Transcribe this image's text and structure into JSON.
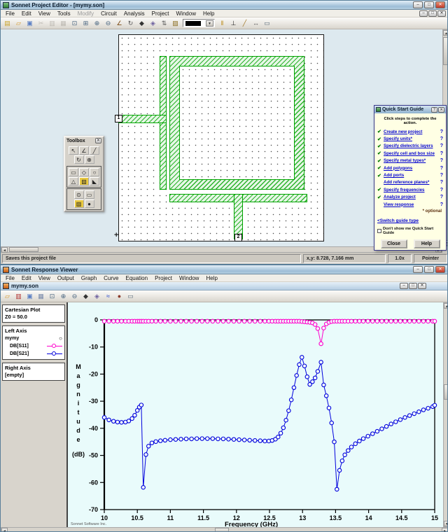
{
  "ui": {
    "scroll_up": "▲",
    "scroll_down": "▼",
    "scroll_left": "◄",
    "scroll_right": "►",
    "dropdown_arrow": "▼",
    "origin_glyph": "+",
    "marker_circle": "○",
    "help_mark": "?"
  },
  "editor": {
    "title": "Sonnet Project Editor - [mymy.son]",
    "window_buttons": [
      {
        "n": "editor-minimize-button",
        "g": "–"
      },
      {
        "n": "editor-maximize-button",
        "g": "□"
      },
      {
        "n": "editor-close-button",
        "g": "✕",
        "cls": "close"
      }
    ],
    "mdi_buttons": [
      {
        "n": "doc-minimize-button",
        "g": "–"
      },
      {
        "n": "doc-restore-button",
        "g": "□"
      },
      {
        "n": "doc-close-button",
        "g": "✕"
      }
    ],
    "menus": [
      {
        "label": "File"
      },
      {
        "label": "Edit"
      },
      {
        "label": "View"
      },
      {
        "label": "Tools"
      },
      {
        "label": "Modify",
        "disabled": true
      },
      {
        "label": "Circuit"
      },
      {
        "label": "Analysis"
      },
      {
        "label": "Project"
      },
      {
        "label": "Window"
      },
      {
        "label": "Help"
      }
    ],
    "toolbar": {
      "icons_left": [
        {
          "n": "new-icon",
          "g": "▤",
          "c": "#c9a227"
        },
        {
          "n": "open-icon",
          "g": "▱",
          "c": "#d69a2d"
        },
        {
          "n": "save-icon",
          "g": "▣",
          "c": "#5b7fc4"
        },
        {
          "n": "cut-icon",
          "g": "✂",
          "c": "#8a867e",
          "cls": "dim"
        },
        {
          "n": "copy-icon",
          "g": "▥",
          "c": "#8a867e",
          "cls": "dim"
        },
        {
          "n": "paste-icon",
          "g": "▦",
          "c": "#8a867e",
          "cls": "dim"
        },
        {
          "n": "fit-view-icon",
          "g": "⊡",
          "c": "#46637f"
        },
        {
          "n": "zoom-box-icon",
          "g": "⊞",
          "c": "#46637f"
        },
        {
          "n": "zoom-in-icon",
          "g": "⊕",
          "c": "#46637f"
        },
        {
          "n": "zoom-out-icon",
          "g": "⊖",
          "c": "#46637f"
        },
        {
          "n": "measure-icon",
          "g": "∠",
          "c": "#7c4a12"
        },
        {
          "n": "rotate-icon",
          "g": "↻",
          "c": "#555555"
        },
        {
          "n": "cell-size-icon",
          "g": "◆",
          "c": "#333333"
        },
        {
          "n": "view-3d-icon",
          "g": "◈",
          "c": "#6b5e9e"
        },
        {
          "n": "layer-up-icon",
          "g": "⇅",
          "c": "#555555"
        },
        {
          "n": "metal-layer-icon",
          "g": "▨",
          "c": "#8a6d1f"
        }
      ],
      "metal_swatch_color": "#000000",
      "icons_right": [
        {
          "n": "via-icon",
          "g": "‖",
          "c": "#b8860b"
        },
        {
          "n": "port-icon",
          "g": "⊥",
          "c": "#222222"
        },
        {
          "n": "ruler-icon",
          "g": "╱",
          "c": "#a07828"
        },
        {
          "n": "dimension-icon",
          "g": "↔",
          "c": "#555555"
        },
        {
          "n": "print-icon",
          "g": "▭",
          "c": "#5a6b7a"
        }
      ]
    },
    "ports": {
      "port1": "1",
      "port2": "2"
    },
    "toolbox": {
      "title": "Toolbox",
      "groups": [
        {
          "boxed": false,
          "rows": [
            [
              {
                "n": "pointer-tool",
                "g": "↖"
              },
              {
                "n": "dimension-tool",
                "g": "∠"
              },
              {
                "n": "measure-tool",
                "g": "╱"
              }
            ],
            [
              {
                "n": "rotate-tool",
                "g": "↻"
              },
              {
                "n": "zoom-tool",
                "g": "⊕"
              }
            ]
          ]
        },
        {
          "boxed": true,
          "rows": [
            [
              {
                "n": "draw-rect-tool",
                "g": "▭"
              },
              {
                "n": "draw-polygon-tool",
                "g": "◇"
              },
              {
                "n": "draw-circle-tool",
                "g": "○"
              }
            ],
            [
              {
                "n": "triangle-tool",
                "g": "△"
              },
              {
                "n": "via-tool",
                "g": "▨",
                "bg": "#e8c840"
              },
              {
                "n": "wedge-tool",
                "g": "◣"
              }
            ]
          ]
        },
        {
          "boxed": true,
          "rows": [
            [
              {
                "n": "port-tool",
                "g": "⊙"
              },
              {
                "n": "box-tool",
                "g": "▭"
              }
            ],
            [
              {
                "n": "metal-tool",
                "g": "▨",
                "bg": "#e8c840"
              },
              {
                "n": "ground-tool",
                "g": "●"
              }
            ]
          ]
        }
      ]
    },
    "quick_start": {
      "title": "Quick Start Guide",
      "title_buttons": [
        {
          "n": "qsg-help-button",
          "g": "?"
        },
        {
          "n": "qsg-close-button",
          "g": "✕"
        }
      ],
      "intro": "Click steps to complete the action.",
      "checkmark": "✔",
      "items": [
        {
          "label": "Create new project",
          "checked": true
        },
        {
          "label": "Specify units*",
          "checked": true
        },
        {
          "label": "Specify dielectric layers",
          "checked": true
        },
        {
          "label": "Specify cell and box size",
          "checked": true
        },
        {
          "label": "Specify metal types*",
          "checked": true
        },
        {
          "label": "Add polygons",
          "checked": true
        },
        {
          "label": "Add ports",
          "checked": true
        },
        {
          "label": "Add reference planes*",
          "checked": false
        },
        {
          "label": "Specify frequencies",
          "checked": true
        },
        {
          "label": "Analyze project",
          "checked": true
        },
        {
          "label": "View response",
          "checked": false
        }
      ],
      "optional_note": "* optional",
      "switch_link": "<Switch guide type",
      "dont_show": "Don't show me Quick Start Guide",
      "close_label": "Close",
      "help_label": "Help"
    },
    "statusbar": {
      "hint": "Saves this project file",
      "coords": "x,y: 8.728, 7.166 mm",
      "zoom": "1.0x",
      "mode": "Pointer"
    }
  },
  "viewer": {
    "title": "Sonnet Response Viewer",
    "window_buttons": [
      {
        "n": "viewer-minimize-button",
        "g": "–"
      },
      {
        "n": "viewer-maximize-button",
        "g": "□"
      },
      {
        "n": "viewer-close-button",
        "g": "✕",
        "cls": "close"
      }
    ],
    "doc_tab": "mymy.son",
    "doc_buttons": [
      {
        "n": "plot-minimize-button",
        "g": "–"
      },
      {
        "n": "plot-restore-button",
        "g": "□"
      },
      {
        "n": "plot-close-button",
        "g": "✕"
      }
    ],
    "menus": [
      {
        "label": "File"
      },
      {
        "label": "Edit"
      },
      {
        "label": "View"
      },
      {
        "label": "Output"
      },
      {
        "label": "Graph"
      },
      {
        "label": "Curve"
      },
      {
        "label": "Equation"
      },
      {
        "label": "Project"
      },
      {
        "label": "Window"
      },
      {
        "label": "Help"
      }
    ],
    "toolbar": {
      "icons": [
        {
          "n": "open-icon",
          "g": "▱",
          "c": "#d69a2d"
        },
        {
          "n": "new-graph-icon",
          "g": "▥",
          "c": "#b03030"
        },
        {
          "n": "save-icon",
          "g": "▣",
          "c": "#5b7fc4"
        },
        {
          "n": "copy-icon",
          "g": "▦",
          "c": "#7788aa"
        },
        {
          "n": "fit-view-icon",
          "g": "⊡",
          "c": "#46637f"
        },
        {
          "n": "zoom-in-icon",
          "g": "⊕",
          "c": "#46637f"
        },
        {
          "n": "zoom-out-icon",
          "g": "⊖",
          "c": "#46637f"
        },
        {
          "n": "cell-icon",
          "g": "◆",
          "c": "#333333"
        },
        {
          "n": "view-3d-icon",
          "g": "◈",
          "c": "#6b5e9e"
        },
        {
          "n": "chart-icon",
          "g": "≈",
          "c": "#2244cc"
        },
        {
          "n": "project-icon",
          "g": "●",
          "c": "#8b3a2a"
        },
        {
          "n": "print-icon",
          "g": "▭",
          "c": "#5a6b7a"
        }
      ]
    },
    "left_panel": {
      "plot_type": "Cartesian Plot",
      "z0": "Z0 = 50.0",
      "left_axis_label": "Left Axis",
      "project": "mymy",
      "right_axis_label": "Right Axis",
      "right_axis_value": "[empty]"
    },
    "footer": "Sonnet Software Inc."
  },
  "chart_data": {
    "type": "line",
    "title": "",
    "xlabel": "Frequency (GHz)",
    "ylabel": "Magnitude",
    "ylabel_unit": "(dB)",
    "xlim": [
      10,
      15
    ],
    "ylim": [
      -70,
      0
    ],
    "xticks": [
      10,
      10.5,
      11,
      11.5,
      12,
      12.5,
      13,
      13.5,
      14,
      14.5,
      15
    ],
    "yticks": [
      0,
      -10,
      -20,
      -30,
      -40,
      -50,
      -60,
      -70
    ],
    "grid": false,
    "legend_position": "left-panel",
    "x": [
      10,
      10.07,
      10.14,
      10.2,
      10.26,
      10.32,
      10.37,
      10.42,
      10.46,
      10.5,
      10.53,
      10.56,
      10.59,
      10.63,
      10.67,
      10.72,
      10.78,
      10.85,
      10.92,
      11,
      11.08,
      11.16,
      11.24,
      11.32,
      11.4,
      11.48,
      11.56,
      11.64,
      11.72,
      11.8,
      11.88,
      11.96,
      12.04,
      12.12,
      12.2,
      12.28,
      12.36,
      12.43,
      12.49,
      12.54,
      12.59,
      12.63,
      12.67,
      12.71,
      12.75,
      12.79,
      12.83,
      12.87,
      12.91,
      12.95,
      12.99,
      13.03,
      13.07,
      13.11,
      13.15,
      13.19,
      13.23,
      13.28,
      13.32,
      13.36,
      13.4,
      13.44,
      13.48,
      13.52,
      13.56,
      13.6,
      13.64,
      13.69,
      13.74,
      13.8,
      13.86,
      13.92,
      13.99,
      14.06,
      14.13,
      14.2,
      14.27,
      14.34,
      14.41,
      14.48,
      14.55,
      14.62,
      14.69,
      14.76,
      14.83,
      14.9,
      14.97,
      15
    ],
    "series": [
      {
        "name": "DB[S11]",
        "color": "#ff00cc",
        "db": [
          -0.5,
          -0.5,
          -0.5,
          -0.5,
          -0.5,
          -0.5,
          -0.5,
          -0.5,
          -0.5,
          -0.5,
          -0.5,
          -0.5,
          -0.5,
          -0.5,
          -0.5,
          -0.5,
          -0.5,
          -0.5,
          -0.5,
          -0.5,
          -0.5,
          -0.5,
          -0.5,
          -0.5,
          -0.5,
          -0.5,
          -0.5,
          -0.5,
          -0.5,
          -0.5,
          -0.5,
          -0.5,
          -0.5,
          -0.5,
          -0.5,
          -0.5,
          -0.5,
          -0.5,
          -0.5,
          -0.5,
          -0.5,
          -0.5,
          -0.5,
          -0.5,
          -0.5,
          -0.5,
          -0.5,
          -0.5,
          -0.5,
          -0.5,
          -0.6,
          -0.7,
          -0.8,
          -0.9,
          -1.1,
          -1.7,
          -3.2,
          -8.8,
          -3.0,
          -1.5,
          -0.9,
          -0.6,
          -0.5,
          -0.5,
          -0.5,
          -0.5,
          -0.5,
          -0.5,
          -0.5,
          -0.5,
          -0.5,
          -0.5,
          -0.5,
          -0.5,
          -0.5,
          -0.5,
          -0.5,
          -0.5,
          -0.5,
          -0.5,
          -0.5,
          -0.5,
          -0.5,
          -0.5,
          -0.5,
          -0.5,
          -0.5,
          -0.5
        ]
      },
      {
        "name": "DB[S21]",
        "color": "#0000dd",
        "db": [
          -36,
          -36.9,
          -37.4,
          -37.7,
          -37.8,
          -37.7,
          -37.3,
          -36.4,
          -35.2,
          -33.4,
          -32.2,
          -31.4,
          -61.8,
          -49.7,
          -46.6,
          -45.4,
          -44.9,
          -44.6,
          -44.4,
          -44.2,
          -44.1,
          -44,
          -43.9,
          -43.9,
          -43.8,
          -43.8,
          -43.8,
          -43.8,
          -43.9,
          -43.9,
          -44,
          -44.1,
          -44.2,
          -44.3,
          -44.4,
          -44.5,
          -44.6,
          -44.7,
          -44.7,
          -44.5,
          -44,
          -43.2,
          -41.8,
          -39.8,
          -37,
          -33.5,
          -29.5,
          -25,
          -20.5,
          -16.5,
          -13.8,
          -17,
          -21,
          -23.8,
          -22.8,
          -21.4,
          -19,
          -15.6,
          -24,
          -28,
          -32.5,
          -38,
          -45,
          -62.5,
          -55.5,
          -52,
          -49.8,
          -48.2,
          -46.9,
          -45.7,
          -44.7,
          -43.8,
          -42.9,
          -42,
          -41.1,
          -40.2,
          -39.3,
          -38.4,
          -37.6,
          -36.8,
          -36,
          -35.3,
          -34.6,
          -33.9,
          -33.2,
          -32.6,
          -32,
          -31.5
        ]
      }
    ]
  }
}
